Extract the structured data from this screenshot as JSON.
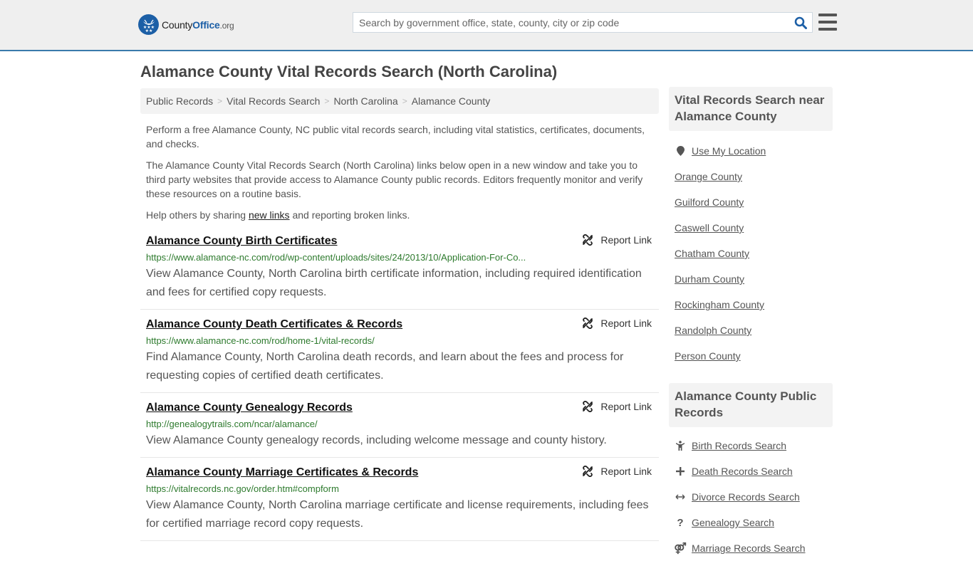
{
  "header": {
    "logo": {
      "county": "County",
      "office": "Office",
      "org": ".org"
    },
    "search_placeholder": "Search by government office, state, county, city or zip code",
    "colors": {
      "accent": "#1c5fa6",
      "border": "#3a7aab"
    }
  },
  "page": {
    "title": "Alamance County Vital Records Search (North Carolina)"
  },
  "breadcrumb": [
    {
      "label": "Public Records"
    },
    {
      "label": "Vital Records Search"
    },
    {
      "label": "North Carolina"
    },
    {
      "label": "Alamance County"
    }
  ],
  "intro": {
    "p1": "Perform a free Alamance County, NC public vital records search, including vital statistics, certificates, documents, and checks.",
    "p2": "The Alamance County Vital Records Search (North Carolina) links below open in a new window and take you to third party websites that provide access to Alamance County public records. Editors frequently monitor and verify these resources on a routine basis.",
    "p3_before": "Help others by sharing ",
    "p3_link": "new links",
    "p3_after": " and reporting broken links."
  },
  "report_label": "Report Link",
  "results": [
    {
      "title": "Alamance County Birth Certificates",
      "url": "https://www.alamance-nc.com/rod/wp-content/uploads/sites/24/2013/10/Application-For-Co...",
      "desc": "View Alamance County, North Carolina birth certificate information, including required identification and fees for certified copy requests."
    },
    {
      "title": "Alamance County Death Certificates & Records",
      "url": "https://www.alamance-nc.com/rod/home-1/vital-records/",
      "desc": "Find Alamance County, North Carolina death records, and learn about the fees and process for requesting copies of certified death certificates."
    },
    {
      "title": "Alamance County Genealogy Records",
      "url": "http://genealogytrails.com/ncar/alamance/",
      "desc": "View Alamance County genealogy records, including welcome message and county history."
    },
    {
      "title": "Alamance County Marriage Certificates & Records",
      "url": "https://vitalrecords.nc.gov/order.htm#compform",
      "desc": "View Alamance County, North Carolina marriage certificate and license requirements, including fees for certified marriage record copy requests."
    }
  ],
  "sidebar": {
    "nearby": {
      "heading": "Vital Records Search near Alamance County",
      "use_location": "Use My Location",
      "items": [
        "Orange County",
        "Guilford County",
        "Caswell County",
        "Chatham County",
        "Durham County",
        "Rockingham County",
        "Randolph County",
        "Person County"
      ]
    },
    "public_records": {
      "heading": "Alamance County Public Records",
      "items": [
        {
          "label": "Birth Records Search",
          "icon": "child-icon"
        },
        {
          "label": "Death Records Search",
          "icon": "plus-icon"
        },
        {
          "label": "Divorce Records Search",
          "icon": "arrows-horizontal-icon"
        },
        {
          "label": "Genealogy Search",
          "icon": "question-icon"
        },
        {
          "label": "Marriage Records Search",
          "icon": "marriage-icon"
        }
      ]
    }
  }
}
